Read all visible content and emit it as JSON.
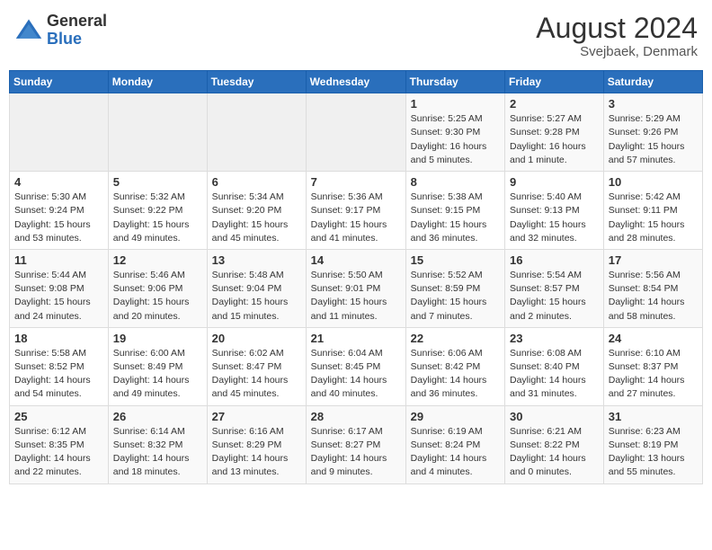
{
  "header": {
    "logo_general": "General",
    "logo_blue": "Blue",
    "month_year": "August 2024",
    "location": "Svejbaek, Denmark"
  },
  "calendar": {
    "days_of_week": [
      "Sunday",
      "Monday",
      "Tuesday",
      "Wednesday",
      "Thursday",
      "Friday",
      "Saturday"
    ],
    "weeks": [
      [
        {
          "day": "",
          "info": ""
        },
        {
          "day": "",
          "info": ""
        },
        {
          "day": "",
          "info": ""
        },
        {
          "day": "",
          "info": ""
        },
        {
          "day": "1",
          "info": "Sunrise: 5:25 AM\nSunset: 9:30 PM\nDaylight: 16 hours\nand 5 minutes."
        },
        {
          "day": "2",
          "info": "Sunrise: 5:27 AM\nSunset: 9:28 PM\nDaylight: 16 hours\nand 1 minute."
        },
        {
          "day": "3",
          "info": "Sunrise: 5:29 AM\nSunset: 9:26 PM\nDaylight: 15 hours\nand 57 minutes."
        }
      ],
      [
        {
          "day": "4",
          "info": "Sunrise: 5:30 AM\nSunset: 9:24 PM\nDaylight: 15 hours\nand 53 minutes."
        },
        {
          "day": "5",
          "info": "Sunrise: 5:32 AM\nSunset: 9:22 PM\nDaylight: 15 hours\nand 49 minutes."
        },
        {
          "day": "6",
          "info": "Sunrise: 5:34 AM\nSunset: 9:20 PM\nDaylight: 15 hours\nand 45 minutes."
        },
        {
          "day": "7",
          "info": "Sunrise: 5:36 AM\nSunset: 9:17 PM\nDaylight: 15 hours\nand 41 minutes."
        },
        {
          "day": "8",
          "info": "Sunrise: 5:38 AM\nSunset: 9:15 PM\nDaylight: 15 hours\nand 36 minutes."
        },
        {
          "day": "9",
          "info": "Sunrise: 5:40 AM\nSunset: 9:13 PM\nDaylight: 15 hours\nand 32 minutes."
        },
        {
          "day": "10",
          "info": "Sunrise: 5:42 AM\nSunset: 9:11 PM\nDaylight: 15 hours\nand 28 minutes."
        }
      ],
      [
        {
          "day": "11",
          "info": "Sunrise: 5:44 AM\nSunset: 9:08 PM\nDaylight: 15 hours\nand 24 minutes."
        },
        {
          "day": "12",
          "info": "Sunrise: 5:46 AM\nSunset: 9:06 PM\nDaylight: 15 hours\nand 20 minutes."
        },
        {
          "day": "13",
          "info": "Sunrise: 5:48 AM\nSunset: 9:04 PM\nDaylight: 15 hours\nand 15 minutes."
        },
        {
          "day": "14",
          "info": "Sunrise: 5:50 AM\nSunset: 9:01 PM\nDaylight: 15 hours\nand 11 minutes."
        },
        {
          "day": "15",
          "info": "Sunrise: 5:52 AM\nSunset: 8:59 PM\nDaylight: 15 hours\nand 7 minutes."
        },
        {
          "day": "16",
          "info": "Sunrise: 5:54 AM\nSunset: 8:57 PM\nDaylight: 15 hours\nand 2 minutes."
        },
        {
          "day": "17",
          "info": "Sunrise: 5:56 AM\nSunset: 8:54 PM\nDaylight: 14 hours\nand 58 minutes."
        }
      ],
      [
        {
          "day": "18",
          "info": "Sunrise: 5:58 AM\nSunset: 8:52 PM\nDaylight: 14 hours\nand 54 minutes."
        },
        {
          "day": "19",
          "info": "Sunrise: 6:00 AM\nSunset: 8:49 PM\nDaylight: 14 hours\nand 49 minutes."
        },
        {
          "day": "20",
          "info": "Sunrise: 6:02 AM\nSunset: 8:47 PM\nDaylight: 14 hours\nand 45 minutes."
        },
        {
          "day": "21",
          "info": "Sunrise: 6:04 AM\nSunset: 8:45 PM\nDaylight: 14 hours\nand 40 minutes."
        },
        {
          "day": "22",
          "info": "Sunrise: 6:06 AM\nSunset: 8:42 PM\nDaylight: 14 hours\nand 36 minutes."
        },
        {
          "day": "23",
          "info": "Sunrise: 6:08 AM\nSunset: 8:40 PM\nDaylight: 14 hours\nand 31 minutes."
        },
        {
          "day": "24",
          "info": "Sunrise: 6:10 AM\nSunset: 8:37 PM\nDaylight: 14 hours\nand 27 minutes."
        }
      ],
      [
        {
          "day": "25",
          "info": "Sunrise: 6:12 AM\nSunset: 8:35 PM\nDaylight: 14 hours\nand 22 minutes."
        },
        {
          "day": "26",
          "info": "Sunrise: 6:14 AM\nSunset: 8:32 PM\nDaylight: 14 hours\nand 18 minutes."
        },
        {
          "day": "27",
          "info": "Sunrise: 6:16 AM\nSunset: 8:29 PM\nDaylight: 14 hours\nand 13 minutes."
        },
        {
          "day": "28",
          "info": "Sunrise: 6:17 AM\nSunset: 8:27 PM\nDaylight: 14 hours\nand 9 minutes."
        },
        {
          "day": "29",
          "info": "Sunrise: 6:19 AM\nSunset: 8:24 PM\nDaylight: 14 hours\nand 4 minutes."
        },
        {
          "day": "30",
          "info": "Sunrise: 6:21 AM\nSunset: 8:22 PM\nDaylight: 14 hours\nand 0 minutes."
        },
        {
          "day": "31",
          "info": "Sunrise: 6:23 AM\nSunset: 8:19 PM\nDaylight: 13 hours\nand 55 minutes."
        }
      ]
    ]
  }
}
